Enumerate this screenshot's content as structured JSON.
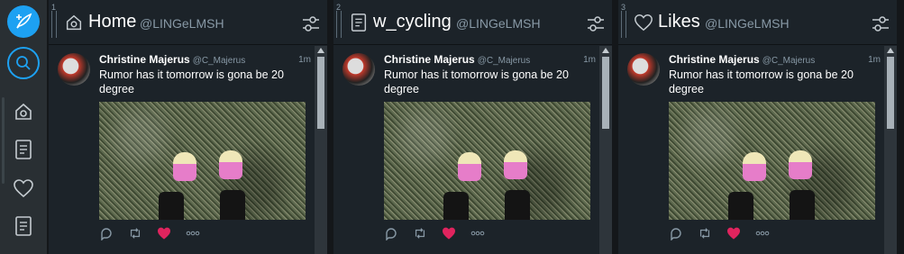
{
  "nav": {
    "compose_icon": "compose-feather-icon",
    "search_icon": "search-icon",
    "items": [
      {
        "icon": "home-icon"
      },
      {
        "icon": "list-icon"
      },
      {
        "icon": "heart-icon"
      },
      {
        "icon": "list-icon"
      }
    ]
  },
  "columns": [
    {
      "number": "1",
      "icon": "home-icon",
      "title": "Home",
      "handle": "@LINGeLMSH"
    },
    {
      "number": "2",
      "icon": "list-icon",
      "title": "w_cycling",
      "handle": "@LINGeLMSH"
    },
    {
      "number": "3",
      "icon": "heart-icon",
      "title": "Likes",
      "handle": "@LINGeLMSH"
    }
  ],
  "tweet": {
    "author": "Christine Majerus",
    "handle": "@C_Majerus",
    "time": "1m",
    "text": "Rumor has it tomorrow is gona be 20 degree",
    "like_color": "#e0245e"
  },
  "colors": {
    "accent": "#1da1f2",
    "background": "#14171a",
    "column": "#1c2329",
    "nav": "#292f33"
  }
}
